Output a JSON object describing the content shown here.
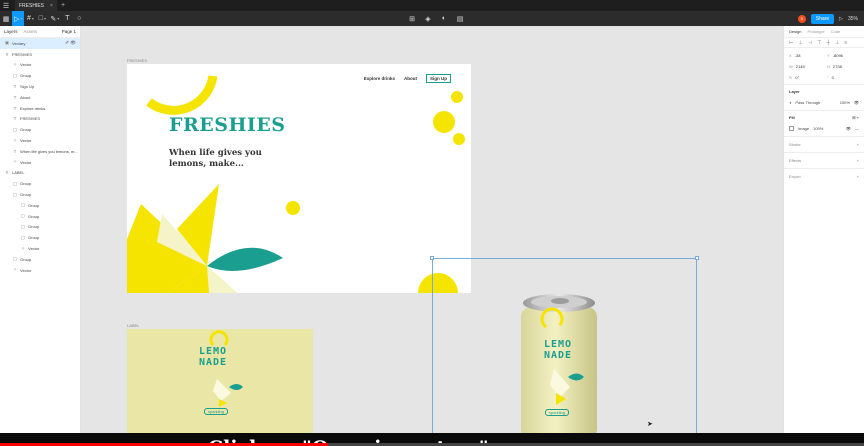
{
  "titlebar": {
    "tab_label": "FRESHIES",
    "close_glyph": "×",
    "plus_glyph": "+",
    "logo_icon": "figma-menu-icon"
  },
  "toolbar": {
    "tools": [
      {
        "name": "move-tool",
        "glyph": "▷",
        "active": true
      },
      {
        "name": "frame-tool",
        "glyph": "#"
      },
      {
        "name": "shape-tool",
        "glyph": "□"
      },
      {
        "name": "pen-tool",
        "glyph": "✎"
      },
      {
        "name": "text-tool",
        "glyph": "T"
      },
      {
        "name": "comment-tool",
        "glyph": "○"
      }
    ],
    "center_icons": [
      "component-icon",
      "mask-icon",
      "contrast-icon",
      "boolean-icon"
    ],
    "center_glyphs": [
      "⊞",
      "◈",
      "◐",
      "▤"
    ],
    "avatar_initial": "S",
    "share_label": "Share",
    "play_glyph": "▷",
    "zoom": "35%"
  },
  "left_panel": {
    "tabs": [
      "Layers",
      "Assets"
    ],
    "page": "Page 1",
    "layers": [
      {
        "label": "Vectary",
        "icon": "▣",
        "indent": 0,
        "selected": true,
        "trail": "✐ 👁"
      },
      {
        "label": "FRESHIES",
        "icon": "#",
        "indent": 0
      },
      {
        "label": "Vector",
        "icon": "✧",
        "indent": 1
      },
      {
        "label": "Group",
        "icon": "▢",
        "indent": 1
      },
      {
        "label": "Sign Up",
        "icon": "T",
        "indent": 1
      },
      {
        "label": "About",
        "icon": "T",
        "indent": 1
      },
      {
        "label": "Explore drinks",
        "icon": "T",
        "indent": 1
      },
      {
        "label": "FRESHIES",
        "icon": "T",
        "indent": 1
      },
      {
        "label": "Group",
        "icon": "▢",
        "indent": 1
      },
      {
        "label": "Vector",
        "icon": "✧",
        "indent": 1
      },
      {
        "label": "When life gives you lemons, m...",
        "icon": "T",
        "indent": 1
      },
      {
        "label": "Vector",
        "icon": "✧",
        "indent": 1
      },
      {
        "label": "LABEL",
        "icon": "#",
        "indent": 0
      },
      {
        "label": "Group",
        "icon": "▢",
        "indent": 1
      },
      {
        "label": "Group",
        "icon": "▢",
        "indent": 1
      },
      {
        "label": "Group",
        "icon": "▢",
        "indent": 2
      },
      {
        "label": "Group",
        "icon": "▢",
        "indent": 2
      },
      {
        "label": "Group",
        "icon": "▢",
        "indent": 2
      },
      {
        "label": "Group",
        "icon": "▢",
        "indent": 2
      },
      {
        "label": "Vector",
        "icon": "✧",
        "indent": 2
      },
      {
        "label": "Group",
        "icon": "▢",
        "indent": 1
      },
      {
        "label": "Vector",
        "icon": "✧",
        "indent": 1
      }
    ]
  },
  "right_panel": {
    "tabs": [
      "Design",
      "Prototype",
      "Code"
    ],
    "align_glyphs": [
      "⊢",
      "⊥",
      "⊣",
      "⊤",
      "┼",
      "⊥",
      "≡"
    ],
    "x": "-38",
    "y": "-8096",
    "w": "2145",
    "h": "2738",
    "rotation": "0°",
    "radius": "0",
    "layer_title": "Layer",
    "blend": "Pass Through",
    "opacity": "100%",
    "fill_title": "Fill",
    "fill_type": "Image",
    "fill_opacity": "100%",
    "sections": [
      "Stroke",
      "Effects",
      "Export"
    ]
  },
  "canvas": {
    "frame1_label": "FRESHIES",
    "frame2_label": "LABEL",
    "nav": [
      "Explore drinks",
      "About",
      "Sign Up"
    ],
    "brand": "FRESHIES",
    "tagline_line1": "When life gives you",
    "tagline_line2": "lemons, make...",
    "label_line1": "LEMO",
    "label_line2": "NADE",
    "label_sparkling": "sparkling",
    "colors": {
      "teal": "#1a9e8f",
      "yellow": "#f5e400",
      "pale": "#f5f3c8",
      "label_bg": "#eae7a6",
      "selection": "#7aaad9"
    }
  },
  "video": {
    "caption": "Click on \"Open in vectary\"",
    "progress": 0.38
  }
}
